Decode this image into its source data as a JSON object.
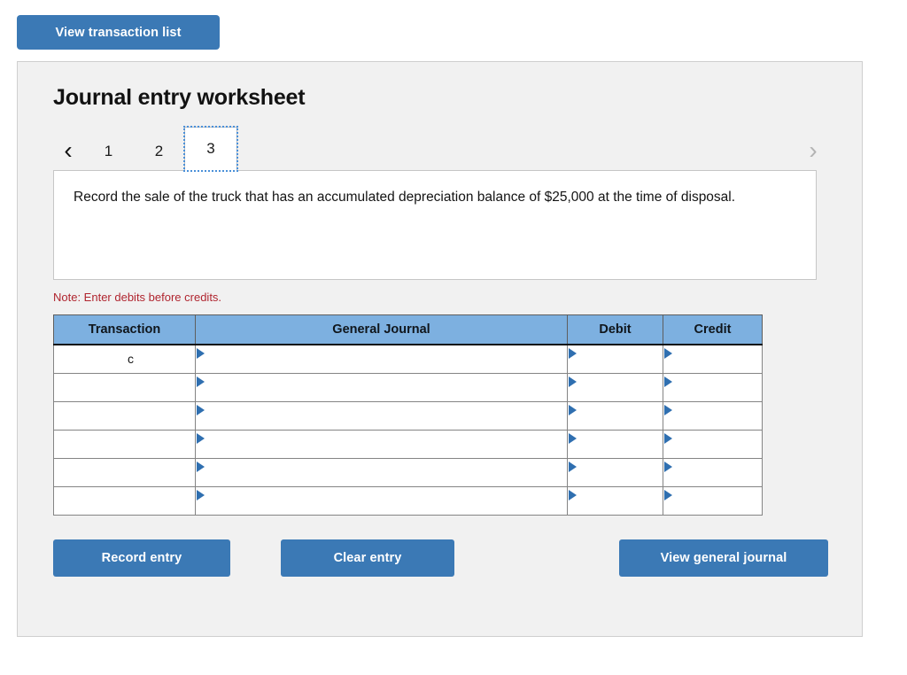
{
  "toolbar": {
    "view_transaction_list_label": "View transaction list"
  },
  "panel": {
    "title": "Journal entry worksheet"
  },
  "pager": {
    "prev_icon": "‹",
    "next_icon": "›",
    "pages": [
      {
        "label": "1",
        "active": false
      },
      {
        "label": "2",
        "active": false
      },
      {
        "label": "3",
        "active": true
      }
    ]
  },
  "prompt": {
    "text": "Record the sale of the truck that has an accumulated depreciation balance of $25,000 at the time of disposal."
  },
  "note": {
    "text": "Note: Enter debits before credits."
  },
  "table": {
    "headers": {
      "transaction": "Transaction",
      "general_journal": "General Journal",
      "debit": "Debit",
      "credit": "Credit"
    },
    "rows": [
      {
        "transaction": "c",
        "general_journal": "",
        "debit": "",
        "credit": ""
      },
      {
        "transaction": "",
        "general_journal": "",
        "debit": "",
        "credit": ""
      },
      {
        "transaction": "",
        "general_journal": "",
        "debit": "",
        "credit": ""
      },
      {
        "transaction": "",
        "general_journal": "",
        "debit": "",
        "credit": ""
      },
      {
        "transaction": "",
        "general_journal": "",
        "debit": "",
        "credit": ""
      },
      {
        "transaction": "",
        "general_journal": "",
        "debit": "",
        "credit": ""
      }
    ]
  },
  "actions": {
    "record_entry_label": "Record entry",
    "clear_entry_label": "Clear entry",
    "view_general_journal_label": "View general journal"
  },
  "colors": {
    "button_blue": "#3b79b5",
    "table_header_blue": "#7db0e0",
    "note_red": "#b0252f",
    "panel_background": "#f1f1f1",
    "marker_blue": "#2f6fb0"
  }
}
